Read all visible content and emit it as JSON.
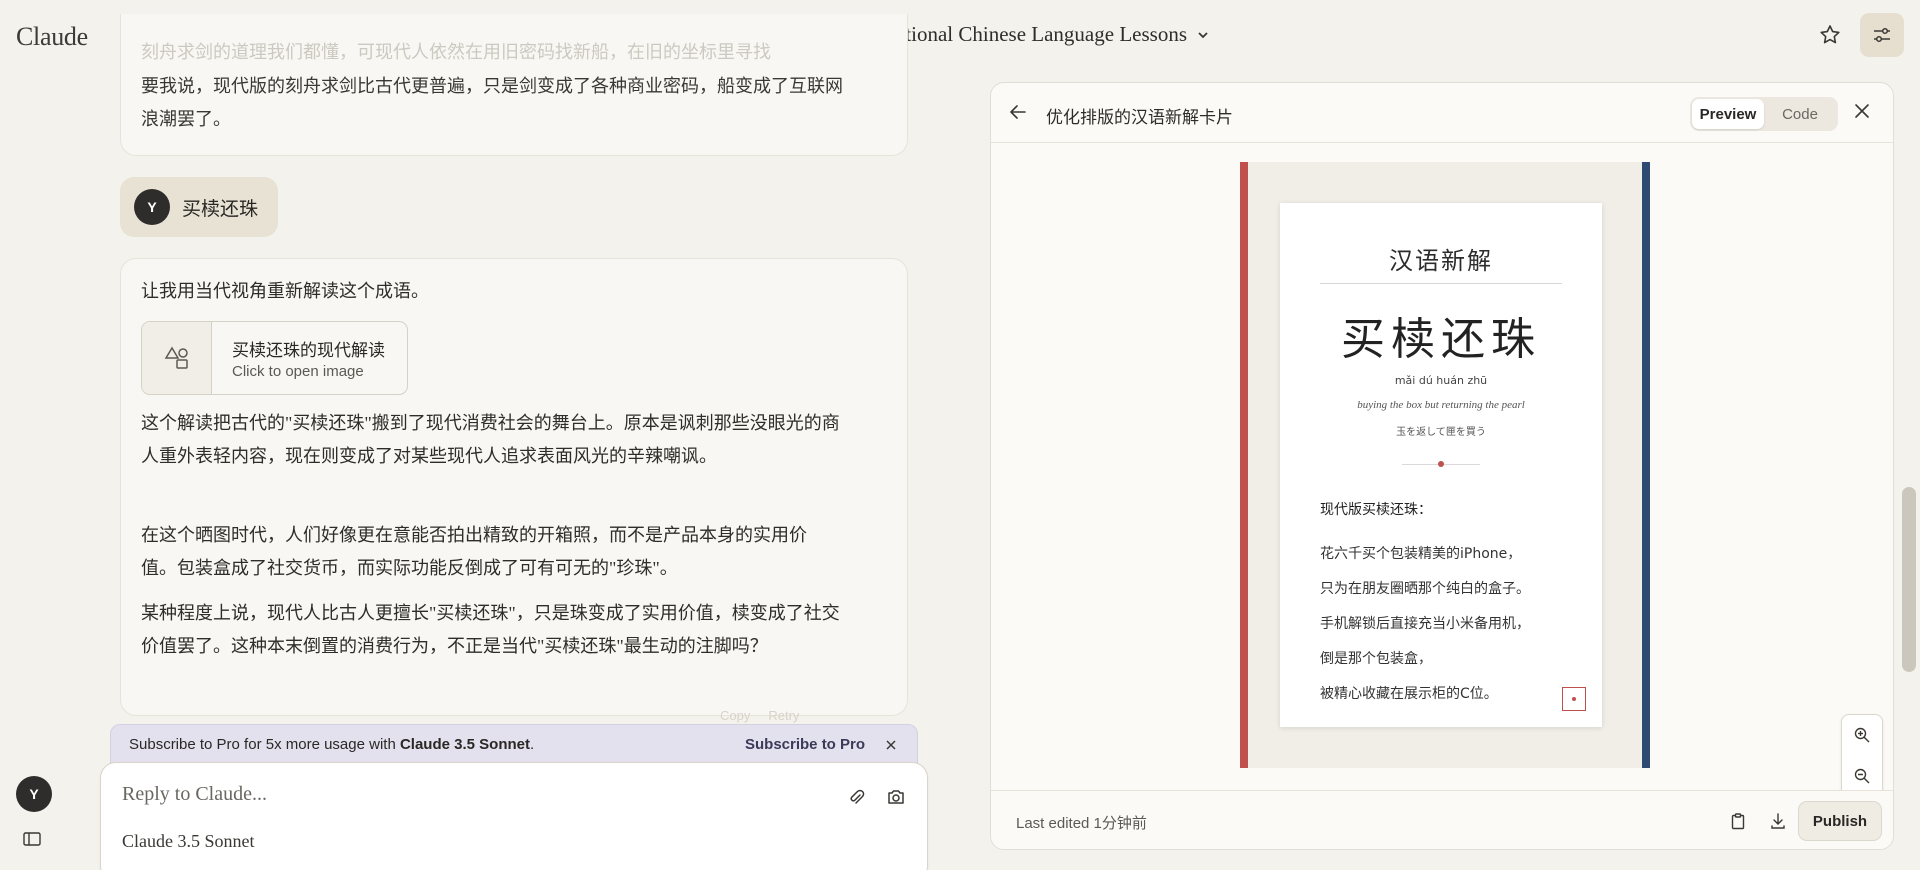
{
  "app": {
    "logo": "Claude"
  },
  "header": {
    "conversation_title": "Unconventional Chinese Language Lessons"
  },
  "chat": {
    "top_faded_text": "刻舟求剑的道理我们都懂，可现代人依然在用旧密码找新船，在旧的坐标里寻找",
    "top_text": "要我说，现代版的刻舟求剑比古代更普遍，只是剑变成了各种商业密码，船变成了互联网浪潮罢了。",
    "user": {
      "avatar_initial": "Y",
      "message": "买椟还珠"
    },
    "response": {
      "intro": "让我用当代视角重新解读这个成语。",
      "artifact_title": "买椟还珠的现代解读",
      "artifact_subtitle": "Click to open image",
      "paragraphs": [
        "这个解读把古代的\"买椟还珠\"搬到了现代消费社会的舞台上。原本是讽刺那些没眼光的商人重外表轻内容，现在则变成了对某些现代人追求表面风光的辛辣嘲讽。",
        "在这个晒图时代，人们好像更在意能否拍出精致的开箱照，而不是产品本身的实用价值。包装盒成了社交货币，而实际功能反倒成了可有可无的\"珍珠\"。",
        "某种程度上说，现代人比古人更擅长\"买椟还珠\"，只是珠变成了实用价值，椟变成了社交价值罢了。这种本末倒置的消费行为，不正是当代\"买椟还珠\"最生动的注脚吗？"
      ],
      "actions": {
        "copy": "Copy",
        "retry": "Retry"
      }
    }
  },
  "banner": {
    "text_prefix": "Subscribe to Pro for 5x more usage with ",
    "text_bold": "Claude 3.5 Sonnet",
    "text_suffix": ".",
    "cta": "Subscribe to Pro"
  },
  "composer": {
    "placeholder": "Reply to Claude...",
    "model": "Claude 3.5 Sonnet"
  },
  "sidebar": {
    "avatar_initial": "Y"
  },
  "panel": {
    "title": "优化排版的汉语新解卡片",
    "tabs": {
      "preview": "Preview",
      "code": "Code"
    },
    "last_edited": "Last edited 1分钟前",
    "publish": "Publish"
  },
  "card": {
    "heading": "汉语新解",
    "idiom": "买椟还珠",
    "pinyin": "mǎi dú huán zhū",
    "english": "buying the box but returning the pearl",
    "japanese": "玉を返して匣を買う",
    "subheading": "现代版买椟还珠：",
    "lines": [
      "花六千买个包装精美的iPhone，",
      "只为在朋友圈晒那个纯白的盒子。",
      "手机解锁后直接充当小米备用机，",
      "倒是那个包装盒，",
      "被精心收藏在展示柜的C位。"
    ]
  },
  "colors": {
    "accent_red": "#c0504d",
    "accent_navy": "#2e4a72",
    "background": "#f4f2ec"
  },
  "icons": [
    "chat-bubble-icon",
    "chevron-down-icon",
    "star-icon",
    "settings-sliders-icon",
    "shapes-icon",
    "paperclip-icon",
    "camera-icon",
    "close-icon",
    "back-arrow-icon",
    "clipboard-icon",
    "download-icon",
    "zoom-in-icon",
    "zoom-out-icon",
    "expand-icon",
    "sidebar-toggle-icon"
  ]
}
